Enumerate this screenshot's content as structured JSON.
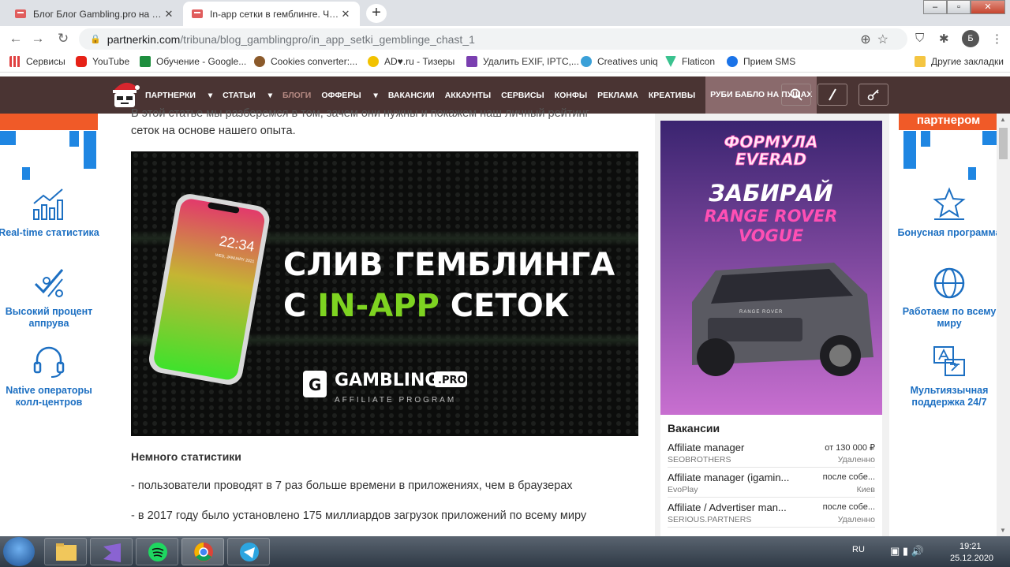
{
  "browser": {
    "tabs": [
      {
        "title": "Блог Блог Gambling.pro на Парт",
        "active": false
      },
      {
        "title": "In-app сетки в гемблинге. Часть",
        "active": true
      }
    ],
    "new_tab": "+",
    "url_host": "partnerkin.com",
    "url_path": "/tribuna/blog_gamblingpro/in_app_setki_gemblinge_chast_1",
    "profile_letter": "Б",
    "bookmarks": [
      "Сервисы",
      "YouTube",
      "Обучение - Google...",
      "Cookies converter:...",
      "AD♥.ru - Тизеры",
      "Удалить EXIF, IPTC,...",
      "Creatives uniq",
      "Flaticon",
      "Прием SMS"
    ],
    "other_bookmarks": "Другие закладки"
  },
  "site": {
    "menu": [
      "ПАРТНЕРКИ",
      "СТАТЬИ",
      "БЛОГИ",
      "ОФФЕРЫ",
      "ВАКАНСИИ",
      "АККАУНТЫ",
      "СЕРВИСЫ",
      "КОНФЫ",
      "РЕКЛАМА",
      "КРЕАТИВЫ"
    ],
    "promo": "РУБИ БАБЛО НА ПУШАХ"
  },
  "left_banner": {
    "features": [
      "Real-time статистика",
      "Высокий процент аппрува",
      "Native операторы колл-центров"
    ]
  },
  "right_banner": {
    "top_label": "партнером",
    "features": [
      "Бонусная программа",
      "Работаем по всему миру",
      "Мультиязычная поддержка 24/7"
    ]
  },
  "article": {
    "intro_line1": "В этой статье мы разберемся в том, зачем они нужны и покажем наш личный рейтинг",
    "intro_line2": "сеток на основе нашего опыта.",
    "banner": {
      "headline1": "СЛИВ ГЕМБЛИНГА",
      "headline2_a": "С ",
      "headline2_b": "IN-APP",
      "headline2_c": " СЕТОК",
      "phone_time": "22:34",
      "phone_date": "WED, JANUARY 2021",
      "brand": "GAMBLING",
      "brand_suffix": ".PRO",
      "brand_sub": "AFFILIATE PROGRAM"
    },
    "stats_heading": "Немного статистики",
    "stat1": "- пользователи проводят в 7 раз больше времени в приложениях, чем в браузерах",
    "stat2": "- в 2017 году было установлено 175 миллиардов загрузок приложений по всему миру"
  },
  "ad": {
    "line1": "ФОРМУЛА",
    "line2": "EVERAD",
    "line3": "ЗАБИРАЙ",
    "line4": "RANGE ROVER",
    "line5": "VOGUE",
    "car_badge": "RANGE ROVER"
  },
  "jobs": {
    "title": "Вакансии",
    "items": [
      {
        "title": "Affiliate manager",
        "salary": "от 130 000 ₽",
        "company": "SEOBROTHERS",
        "location": "Удаленно"
      },
      {
        "title": "Affiliate manager (igamin...",
        "salary": "после собе...",
        "company": "EvoPlay",
        "location": "Киев"
      },
      {
        "title": "Affiliate / Advertiser man...",
        "salary": "после собе...",
        "company": "SERIOUS.PARTNERS",
        "location": "Удаленно"
      }
    ]
  },
  "taskbar": {
    "lang": "RU",
    "time": "19:21",
    "date": "25.12.2020"
  },
  "colors": {
    "site_header": "#4a3433",
    "accent_orange": "#f05a28",
    "feature_blue": "#1c6fc2",
    "banner_green": "#7ed321",
    "ad_pink": "#ff4fb4"
  }
}
